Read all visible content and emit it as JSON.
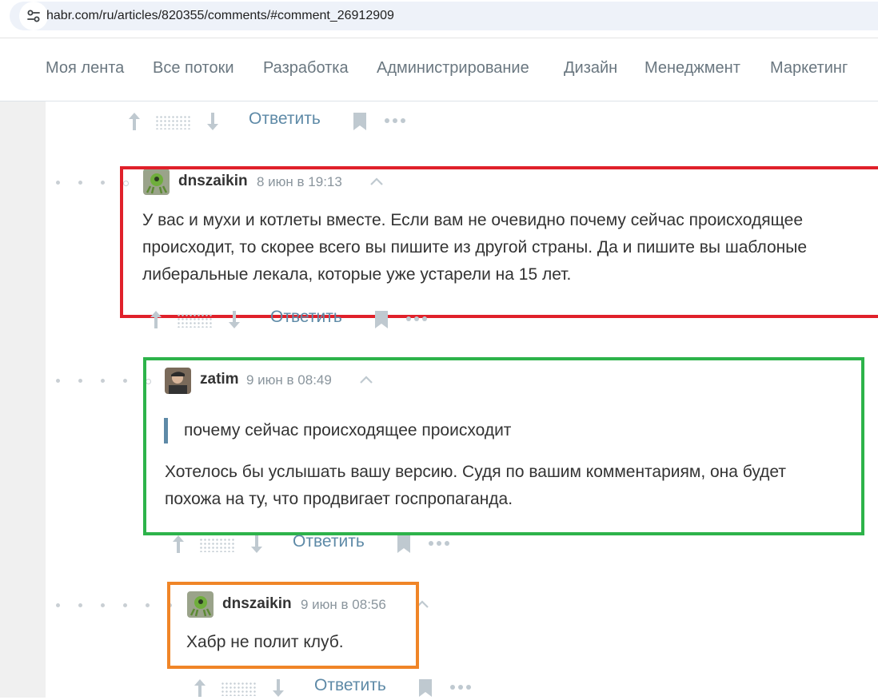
{
  "browser": {
    "url": "habr.com/ru/articles/820355/comments/#comment_26912909",
    "site_settings_icon": "tune-icon"
  },
  "nav": {
    "items": [
      "Моя лента",
      "Все потоки",
      "Разработка",
      "Администрирование",
      "Дизайн",
      "Менеджмент",
      "Маркетинг"
    ]
  },
  "actions": {
    "reply_label": "Ответить",
    "upvote_icon": "arrow-up-icon",
    "downvote_icon": "arrow-down-icon",
    "bookmark_icon": "bookmark-icon",
    "more_icon": "more-horizontal-icon"
  },
  "comments": [
    {
      "author": "dnszaikin",
      "time": "8 июн в 19:13",
      "lines": [
        "У вас и мухи и котлеты вместе. Если вам не очевидно почему сейчас происходящее",
        "происходит, то скорее всего вы пишите из другой страны. Да и пишите вы шаблоные",
        "либеральные лекала, которые уже устарели на 15 лет."
      ],
      "highlight_color": "#e0202a"
    },
    {
      "author": "zatim",
      "time": "9 июн в 08:49",
      "quote": "почему сейчас происходящее происходит",
      "lines": [
        "Хотелось бы услышать вашу версию. Судя по вашим комментариям, она будет",
        "похожа на ту, что продвигает госпропаганда."
      ],
      "highlight_color": "#2db34a"
    },
    {
      "author": "dnszaikin",
      "time": "9 июн в 08:56",
      "lines": [
        "Хабр не полит клуб."
      ],
      "highlight_color": "#f08527"
    }
  ],
  "colors": {
    "link": "#5e8aa7",
    "text": "#333333",
    "meta": "#8a959d",
    "icon": "#bfc9d0"
  }
}
